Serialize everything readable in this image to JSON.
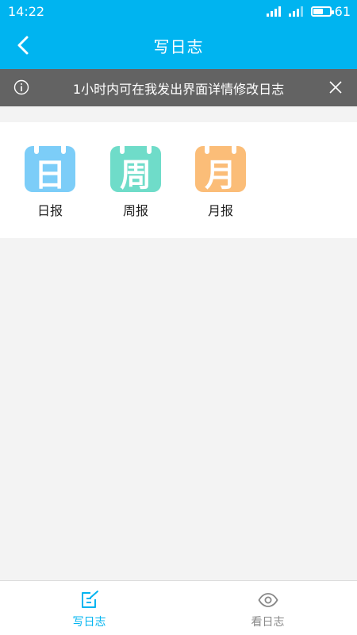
{
  "status_bar": {
    "time": "14:22",
    "battery_level": "61",
    "battery_fraction": 0.61
  },
  "header": {
    "title": "写日志",
    "back_icon": "chevron-left-icon"
  },
  "notice": {
    "text": "1小时内可在我发出界面详情修改日志",
    "info_icon": "info-icon",
    "close_icon": "close-icon"
  },
  "reports": [
    {
      "icon_char": "日",
      "label": "日报",
      "color": "#7ccdf8"
    },
    {
      "icon_char": "周",
      "label": "周报",
      "color": "#6fdcc9"
    },
    {
      "icon_char": "月",
      "label": "月报",
      "color": "#fbbd78"
    }
  ],
  "bottom_nav": {
    "tabs": [
      {
        "label": "写日志",
        "icon": "edit-note-icon",
        "active": true
      },
      {
        "label": "看日志",
        "icon": "eye-icon",
        "active": false
      }
    ],
    "active_color": "#00b4f0",
    "inactive_color": "#888888"
  },
  "colors": {
    "primary": "#00b4f0",
    "notice_bg": "#636363",
    "page_bg": "#f3f3f3"
  }
}
